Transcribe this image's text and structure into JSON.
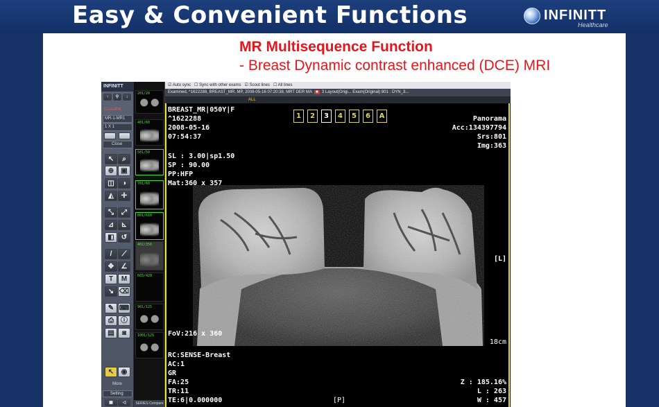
{
  "slide": {
    "title": "Easy & Convenient Functions",
    "logo_word": "INFINITT",
    "logo_sub": "Healthcare",
    "subtitle_1": "MR Multisequence Function",
    "subtitle_2": "- Breast Dynamic contrast enhanced (DCE) MRI",
    "colors": {
      "header_bg": "#173266",
      "subtitle": "#e8141b",
      "body_bg": "#ffffff"
    }
  },
  "viewer": {
    "toolbar": {
      "brand": "INFINITT",
      "crosslink": "Crosslink",
      "series_select": "MR-1-MR1",
      "layout_select": "1 X 1",
      "close": "Close",
      "more": "More",
      "setting": "Setting"
    },
    "top_strip": {
      "items": [
        "Auto sync",
        "Sync with other exams",
        "Scout lines",
        "All lines"
      ]
    },
    "info_strip": "Examined, ^1622288, BREAST_MR, MP, 2008-05-16 07:20:38, MRT DER MA",
    "info_strip_right": "3   Layout(Origi...   Exam(Original)   801 : DYN_3...",
    "ctrl_label": "ALL",
    "thumbnails": [
      {
        "label": "201/20"
      },
      {
        "label": "401/60"
      },
      {
        "label": "501/50"
      },
      {
        "label": "701/60"
      },
      {
        "label": "801/610"
      },
      {
        "label": "402/350"
      },
      {
        "label": "603/420"
      },
      {
        "label": "901/125"
      },
      {
        "label": "1001/125"
      }
    ],
    "thumb_footer": "SERIES  Compare",
    "overlay": {
      "top_left": [
        "BREAST_MR|050Y|F",
        "^1622288",
        "2008-05-16",
        "07:54:37"
      ],
      "mid_left": [
        "SL : 3.00|sp1.50",
        "SP : 90.00",
        "PP:HFP",
        "Mat:360 x 357"
      ],
      "top_right": [
        "Panorama",
        "Acc:134397794",
        "Srs:801",
        "Img:363"
      ],
      "right_marker": "[L]",
      "fov": "FoV:216 x 360",
      "scale": "18cm",
      "bottom_left": [
        "RC:SENSE-Breast",
        "AC:1",
        "GR",
        "FA:25",
        "TR:11",
        "TE:6|0.000000"
      ],
      "bottom_center": "[P]",
      "bottom_right": [
        "Z : 185.16%",
        "L : 263",
        "W : 457"
      ]
    },
    "pages": [
      "1",
      "2",
      "3",
      "4",
      "5",
      "6",
      "A"
    ],
    "active_page": "3"
  }
}
